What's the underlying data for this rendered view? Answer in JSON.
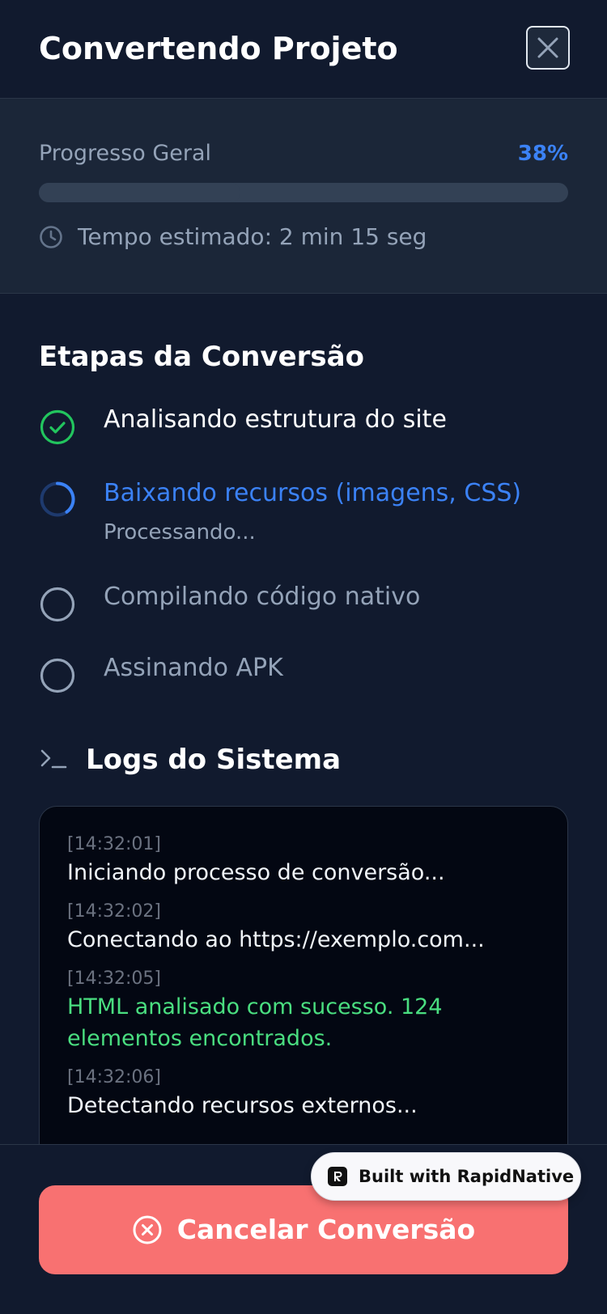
{
  "header": {
    "title": "Convertendo Projeto"
  },
  "progress": {
    "label": "Progresso Geral",
    "percent_text": "38%",
    "percent_value": 38,
    "eta_text": "Tempo estimado: 2 min 15 seg"
  },
  "steps": {
    "title": "Etapas da Conversão",
    "items": [
      {
        "label": "Analisando estrutura do site",
        "status": "done"
      },
      {
        "label": "Baixando recursos (imagens, CSS)",
        "status": "active",
        "sub": "Processando..."
      },
      {
        "label": "Compilando código nativo",
        "status": "pending"
      },
      {
        "label": "Assinando APK",
        "status": "pending"
      }
    ]
  },
  "logs": {
    "title": "Logs do Sistema",
    "entries": [
      {
        "time": "[14:32:01]",
        "message": "Iniciando processo de conversão...",
        "level": "info"
      },
      {
        "time": "[14:32:02]",
        "message": "Conectando ao https://exemplo.com...",
        "level": "info"
      },
      {
        "time": "[14:32:05]",
        "message": "HTML analisado com sucesso. 124 elementos encontrados.",
        "level": "success"
      },
      {
        "time": "[14:32:06]",
        "message": "Detectando recursos externos...",
        "level": "info"
      }
    ]
  },
  "footer": {
    "cancel_label": "Cancelar Conversão"
  },
  "badge": {
    "text": "Built with RapidNative"
  },
  "icons": {
    "close": "close-icon",
    "eta": "clock-icon",
    "step_done": "check-circle-icon",
    "step_active": "spinner-icon",
    "step_pending": "empty-circle-icon",
    "logs": "terminal-icon",
    "cancel": "x-circle-icon",
    "badge": "rapidnative-logo-icon"
  },
  "colors": {
    "background": "#111a2e",
    "panel": "#1b2638",
    "accent": "#3b82f6",
    "success": "#22c55e",
    "log_success": "#4ade80",
    "muted": "#94a3b8",
    "danger": "#f87171"
  }
}
